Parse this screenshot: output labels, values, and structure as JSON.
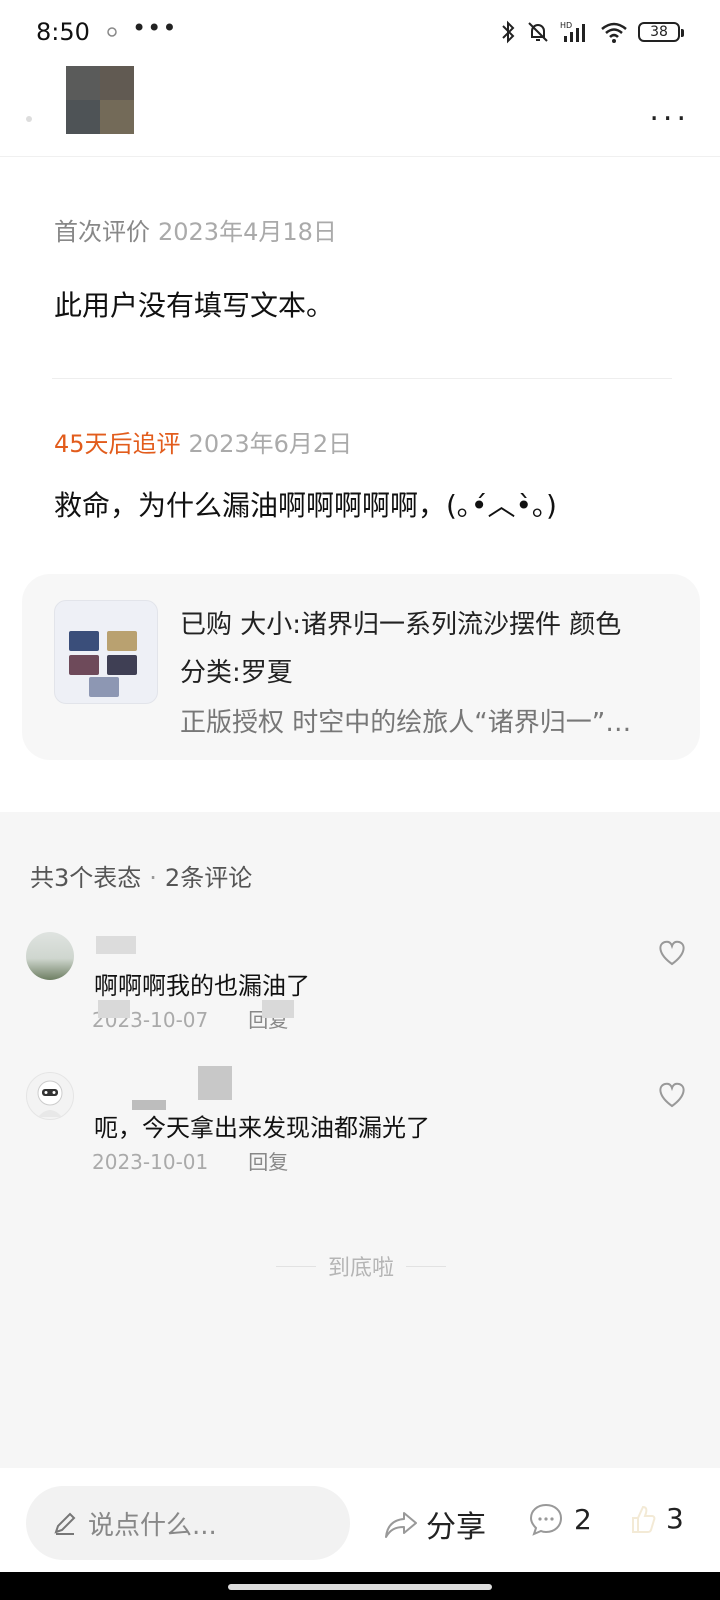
{
  "status_bar": {
    "time": "8:50",
    "more": "•••",
    "battery": "38"
  },
  "header": {
    "more_label": "..."
  },
  "review": {
    "first_label": "首次评价",
    "first_date": "2023年4月18日",
    "first_text": "此用户没有填写文本。",
    "followup_tag": "45天后追评",
    "followup_date": "2023年6月2日",
    "followup_text": "救命，为什么漏油啊啊啊啊啊，(｡•́︿•̀｡)"
  },
  "product": {
    "line1": "已购 大小:诸界归一系列流沙摆件 颜色",
    "line2": "分类:罗夏",
    "line3": "正版授权 时空中的绘旅人“诸界归一”…"
  },
  "comments_header": {
    "reactions": "共3个表态",
    "separator": "·",
    "comments": "2条评论"
  },
  "comments": [
    {
      "text": "啊啊啊我的也漏油了",
      "date": "2023-10-07",
      "reply": "回复"
    },
    {
      "text": "呃，今天拿出来发现油都漏光了",
      "date": "2023-10-01",
      "reply": "回复"
    }
  ],
  "end_text": "到底啦",
  "bottom": {
    "input_placeholder": "说点什么...",
    "share_label": "分享",
    "comment_count": "2",
    "like_count": "3"
  },
  "colors": {
    "accent_orange": "#e25c1c",
    "background_gray": "#f6f6f6"
  }
}
